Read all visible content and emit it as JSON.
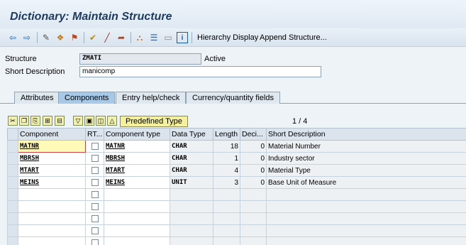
{
  "window": {
    "title": "Dictionary: Maintain Structure"
  },
  "toolbar": {
    "icons": [
      "back-arrow-icon",
      "forward-arrow-icon",
      "display-change-icon",
      "other-object-icon",
      "activate-icon",
      "check-icon",
      "edit-icon",
      "where-used-icon",
      "hierarchy-icon",
      "list-icon",
      "window-icon",
      "info-icon"
    ],
    "hierarchy_display": "Hierarchy Display",
    "append_structure": "Append Structure..."
  },
  "form": {
    "structure_label": "Structure",
    "structure_value": "ZMATI",
    "status": "Active",
    "short_desc_label": "Short Description",
    "short_desc_value": "manicomp"
  },
  "tabs": [
    {
      "label": "Attributes",
      "active": false
    },
    {
      "label": "Components",
      "active": true
    },
    {
      "label": "Entry help/check",
      "active": false
    },
    {
      "label": "Currency/quantity fields",
      "active": false
    }
  ],
  "panel": {
    "predefined_type": "Predefined Type",
    "page_counter": "1 / 4"
  },
  "grid": {
    "headers": [
      "Component",
      "RT...",
      "Component type",
      "Data Type",
      "Length",
      "Deci...",
      "Short Description"
    ],
    "rows": [
      {
        "component": "MATNR",
        "ctype": "MATNR",
        "dtype": "CHAR",
        "length": "18",
        "decimals": "0",
        "desc": "Material Number"
      },
      {
        "component": "MBRSH",
        "ctype": "MBRSH",
        "dtype": "CHAR",
        "length": "1",
        "decimals": "0",
        "desc": "Industry sector"
      },
      {
        "component": "MTART",
        "ctype": "MTART",
        "dtype": "CHAR",
        "length": "4",
        "decimals": "0",
        "desc": "Material Type"
      },
      {
        "component": "MEINS",
        "ctype": "MEINS",
        "dtype": "UNIT",
        "length": "3",
        "decimals": "0",
        "desc": "Base Unit of Measure"
      }
    ]
  }
}
